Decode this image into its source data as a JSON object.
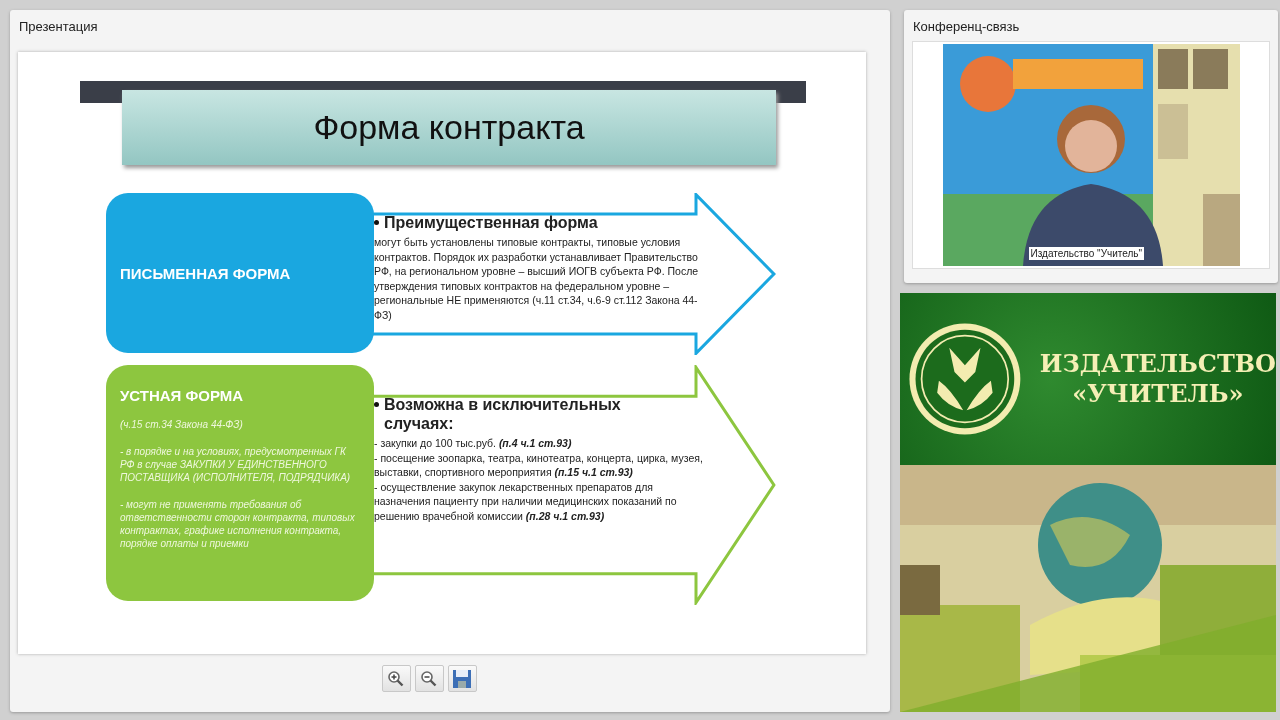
{
  "presentation": {
    "title": "Презентация",
    "slide": {
      "title": "Форма контракта",
      "rows": [
        {
          "kind": "written",
          "color": "#1aa7e0",
          "label": "ПИСЬМЕННАЯ ФОРМА",
          "notes": [],
          "heading": "Преимущественная форма",
          "lines": [
            "могут быть установлены типовые контракты, типовые условия контрактов. Порядок их разработки устанавливает Правительство РФ, на региональном уровне – высший ИОГВ субъекта РФ. После утверждения типовых контрактов на федеральном уровне – региональные НЕ применяются (ч.11 ст.34, ч.6-9 ст.112 Закона 44-ФЗ)"
          ]
        },
        {
          "kind": "oral",
          "color": "#8dc63f",
          "label": "УСТНАЯ ФОРМА",
          "notes": [
            "(ч.15 ст.34 Закона 44-ФЗ)",
            "- в порядке и на условиях, предусмотренных ГК РФ в случае ЗАКУПКИ У ЕДИНСТВЕННОГО ПОСТАВЩИКА (ИСПОЛНИТЕЛЯ, ПОДРЯДЧИКА)",
            "- могут не применять требования об ответственности сторон контракта, типовых контрактах, графике исполнения контракта, порядке оплаты и приемки"
          ],
          "heading": "Возможна в исключительных случаях:",
          "lines": [
            "- закупки до 100 тыс.руб. **(п.4 ч.1 ст.93)**",
            "- посещение зоопарка, театра, кинотеатра, концерта, цирка, музея, выставки, спортивного мероприятия **(п.15 ч.1 ст.93)**",
            "- осуществление закупок лекарственных препаратов для назначения пациенту при наличии медицинских показаний по решению врачебной комиссии **(п.28 ч.1 ст.93)**"
          ]
        }
      ]
    },
    "toolbar": [
      {
        "kind": "zoom-in"
      },
      {
        "kind": "zoom-out"
      },
      {
        "kind": "save"
      }
    ]
  },
  "conference": {
    "title": "Конференц-связь",
    "video": {
      "kind": "picture",
      "caption": "Издательство \"Учитель\""
    }
  },
  "publisher_logo": {
    "lines": [
      "ИЗДАТЕЛЬСТВО",
      "«УЧИТЕЛЬ»"
    ]
  }
}
